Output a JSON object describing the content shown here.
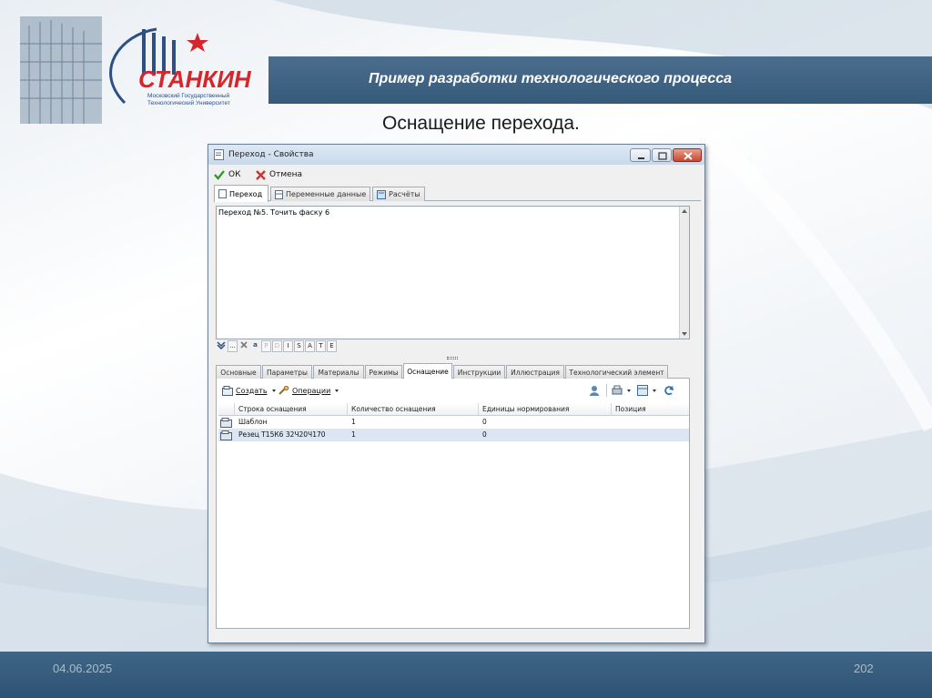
{
  "slide": {
    "title": "Пример разработки технологического процесса",
    "subtitle": "Оснащение перехода.",
    "date": "04.06.2025",
    "page_number": "202"
  },
  "logo": {
    "name": "СТАНКИН",
    "line1": "Московский Государственный",
    "line2": "Технологический Университет"
  },
  "window": {
    "title": "Переход - Свойства",
    "toolbar": {
      "ok": "ОК",
      "cancel": "Отмена"
    },
    "top_tabs": [
      "Переход",
      "Переменные данные",
      "Расчёты"
    ],
    "editor_text": "Переход №5. Точить фаску 6",
    "format_buttons": [
      "P",
      "D",
      "I",
      "S",
      "A",
      "T",
      "E"
    ],
    "bottom_tabs": [
      "Основные",
      "Параметры",
      "Материалы",
      "Режимы",
      "Оснащение",
      "Инструкции",
      "Иллюстрация",
      "Технологический элемент"
    ],
    "active_bottom_tab": "Оснащение",
    "grid_toolbar": {
      "create": "Создать",
      "operations": "Операции"
    },
    "grid": {
      "columns": [
        "Строка оснащения",
        "Количество оснащения",
        "Единицы нормирования",
        "Позиция"
      ],
      "rows": [
        {
          "name": "Шаблон",
          "qty": "1",
          "unit": "0",
          "position": ""
        },
        {
          "name": "Резец Т15К6 32Ч20Ч170",
          "qty": "1",
          "unit": "0",
          "position": ""
        }
      ]
    }
  },
  "colors": {
    "band": "#3f6687",
    "logo_red": "#d4262b",
    "logo_blue": "#2d4f86",
    "selected_row": "#dbe6f2"
  }
}
